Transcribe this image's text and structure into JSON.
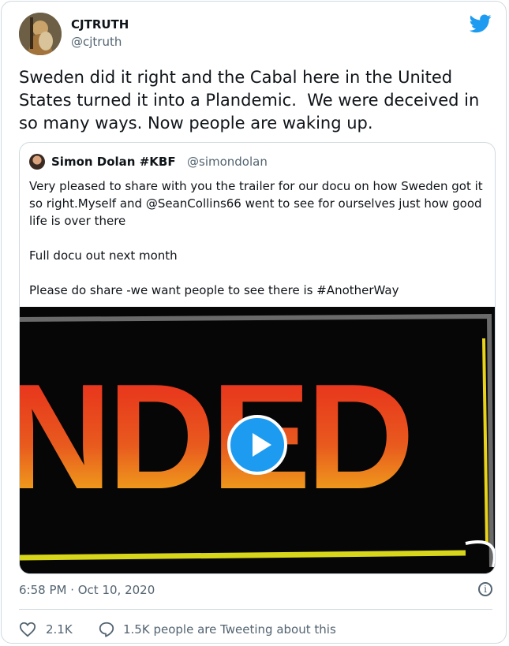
{
  "tweet": {
    "author_name": "CJTRUTH",
    "author_handle": "@cjtruth",
    "text": "Sweden did it right and the Cabal here in the United States turned it into a Plandemic.  We were deceived in so many ways. Now people are waking up.",
    "timestamp": "6:58 PM · Oct 10, 2020",
    "likes": "2.1K",
    "tweeting_about": "1.5K people are Tweeting about this"
  },
  "quoted": {
    "author_name": "Simon Dolan #KBF",
    "author_handle": "@simondolan",
    "text": "Very pleased to share with you the trailer for our docu on how Sweden got it so right.Myself and @SeanCollins66 went to see for ourselves just how good life is over there\n\nFull docu out next month\n\nPlease do share -we want people to see there is #AnotherWay",
    "video_title_text": "NDED"
  },
  "icons": {
    "brand": "twitter-bird-icon",
    "play": "play-icon",
    "info": "info-icon",
    "like": "heart-icon",
    "conversation": "chat-bubble-icon"
  },
  "colors": {
    "accent": "#1d9bf0",
    "secondary_text": "#536471",
    "border": "#cfd9de"
  }
}
